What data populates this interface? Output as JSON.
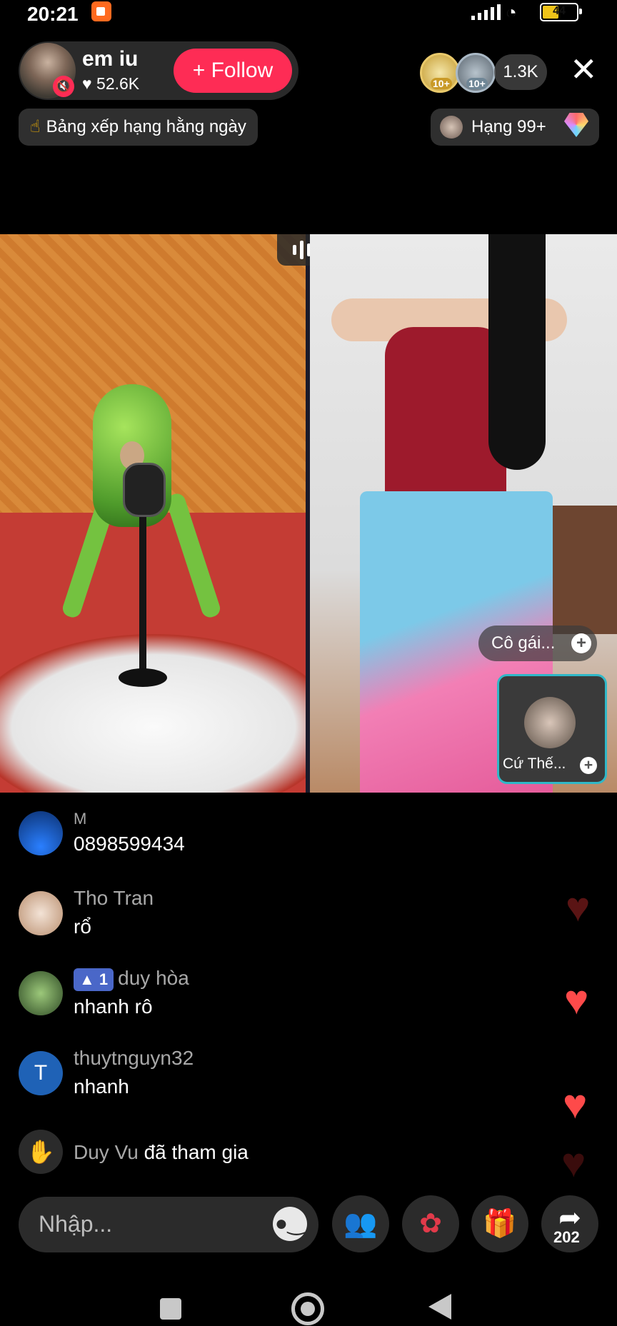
{
  "status_bar": {
    "time": "20:21",
    "battery": "44"
  },
  "host": {
    "name": "em iu",
    "likes": "52.6K",
    "follow_label": "+ Follow"
  },
  "viewers": {
    "badge": "10+",
    "count": "1.3K"
  },
  "ranking": {
    "daily_label": "Bảng xếp hạng hằng ngày",
    "rank_label": "Hạng 99+"
  },
  "pk": {
    "guest_pill_label": "Cô gái...",
    "guest_card_name": "Cứ Thế..."
  },
  "comments": [
    {
      "user": "M",
      "message": "0898599434",
      "avatar_color": "#0d3b8f"
    },
    {
      "user": "Tho Tran",
      "message": "rổ",
      "avatar_color": "#c3a089"
    },
    {
      "user": "duy hòa",
      "level": "1",
      "message": "nhanh rô",
      "avatar_color": "#4f7b3b"
    },
    {
      "user": "thuytnguyn32",
      "message": "nhanh",
      "avatar_initial": "T",
      "avatar_color": "#1f62b6"
    }
  ],
  "join_event": {
    "user": "Duy Vu",
    "action": "đã tham gia"
  },
  "input": {
    "placeholder": "Nhập..."
  },
  "share": {
    "count": "202"
  },
  "colors": {
    "accent": "#fe2c55",
    "guest_border": "#2fb8c8"
  }
}
